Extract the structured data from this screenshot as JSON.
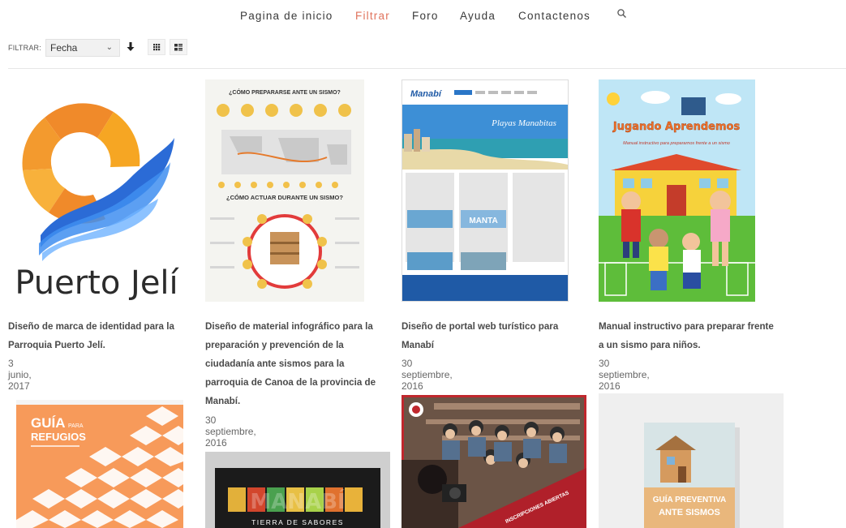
{
  "nav": {
    "items": [
      {
        "label": "Pagina de inicio"
      },
      {
        "label": "Filtrar"
      },
      {
        "label": "Foro"
      },
      {
        "label": "Ayuda"
      },
      {
        "label": "Contactenos"
      }
    ],
    "search_icon": "search-icon"
  },
  "filter": {
    "label": "FILTRAR:",
    "sort_value": "Fecha",
    "sort_direction_icon": "arrow-down-icon",
    "view_grid_icon": "grid-view-icon",
    "view_list_icon": "list-view-icon"
  },
  "cards": [
    {
      "title_lines": [
        "Diseño de marca de identidad para la",
        "Parroquia Puerto Jelí."
      ],
      "date": "3 junio, 2017",
      "thumb_text": "Puerto Jelí"
    },
    {
      "title_lines": [
        "Diseño de material infográfico para la",
        "preparación y prevención de la",
        "ciudadanía ante sismos para la",
        "parroquia de Canoa de la provincia de",
        "Manabí."
      ],
      "date": "30 septiembre, 2016",
      "thumb_top": "¿CÓMO PREPARARSE ANTE UN SISMO?",
      "thumb_mid": "¿CÓMO ACTUAR DURANTE UN SISMO?"
    },
    {
      "title_lines": [
        "Diseño de portal web turístico para",
        "Manabí"
      ],
      "date": "30 septiembre, 2016",
      "thumb_brand": "Manabí",
      "thumb_hero": "Playas Manabitas",
      "thumb_city": "MANTA"
    },
    {
      "title_lines": [
        "Manual instructivo para preparar frente",
        "a un sismo para niños."
      ],
      "date": "30 septiembre, 2016",
      "thumb_title": "Jugando Aprendemos",
      "thumb_sub": "Manual instructivo para prepararnos frente a un sismo"
    },
    {
      "thumb_big": "GUÍA",
      "thumb_para": "PARA",
      "thumb_word": "REFUGIOS"
    },
    {
      "thumb_title": "MANABÍ",
      "thumb_sub": "TIERRA DE SABORES"
    },
    {
      "thumb_banner": "INSCRIPCIONES ABIERTAS"
    },
    {
      "thumb_line1": "GUÍA PREVENTIVA",
      "thumb_line2": "ANTE SISMOS"
    }
  ]
}
